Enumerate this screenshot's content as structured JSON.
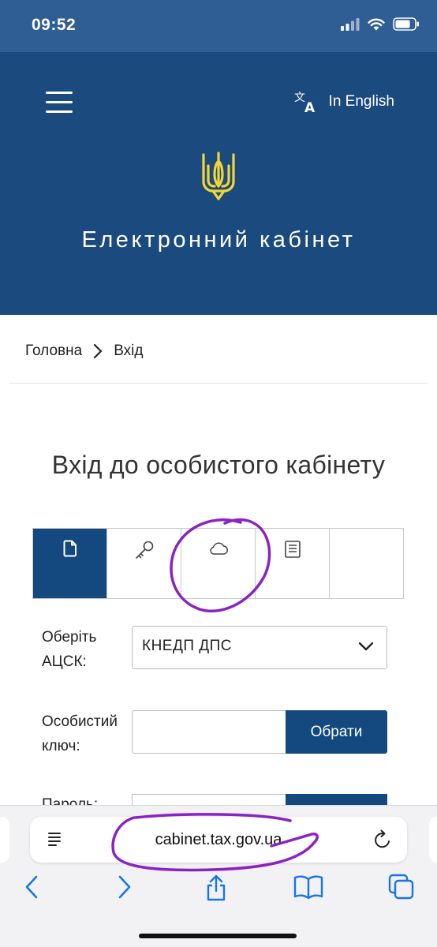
{
  "status_bar": {
    "time": "09:52"
  },
  "header": {
    "language_link": "In English",
    "brand": "Електронний кабінет"
  },
  "breadcrumb": {
    "home": "Головна",
    "current": "Вхід"
  },
  "title": "Вхід до особистого кабінету",
  "tabs": [
    {
      "icon": "file-icon",
      "active": true
    },
    {
      "icon": "key-icon",
      "active": false
    },
    {
      "icon": "cloud-icon",
      "active": false
    },
    {
      "icon": "book-icon",
      "active": false
    },
    {
      "icon": "",
      "active": false
    }
  ],
  "form": {
    "acsk_label_line1": "Оберіть",
    "acsk_label_line2": "АЦСК:",
    "acsk_value": "КНЕДП ДПС",
    "key_label_line1": "Особистий",
    "key_label_line2": "ключ:",
    "choose_button": "Обрати",
    "password_label": "Пароль:"
  },
  "browser": {
    "url": "cabinet.tax.gov.ua"
  },
  "colors": {
    "header_bg": "#1b4a7f",
    "status_bg": "#2f5e94",
    "accent": "#13497f",
    "trident": "#f5d533",
    "annotation": "#8a22c4"
  }
}
